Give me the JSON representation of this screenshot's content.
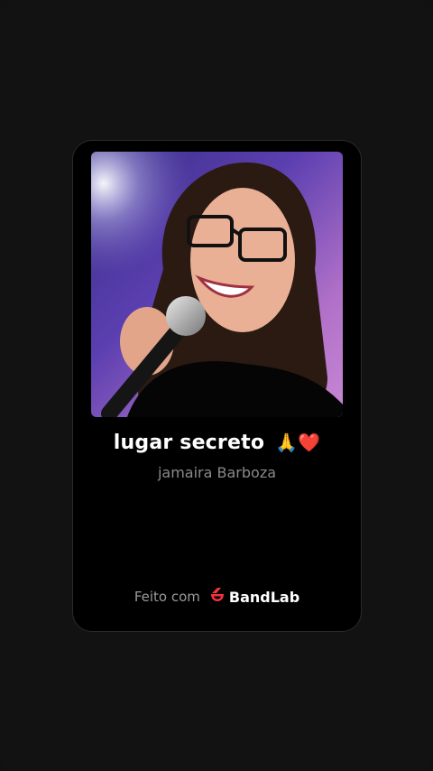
{
  "track": {
    "title": "lugar secreto",
    "title_emojis": "🙏❤️",
    "artist": "jamaira Barboza"
  },
  "footer": {
    "made_with": "Feito com",
    "brand": "BandLab",
    "brand_color": "#f5323c"
  },
  "colors": {
    "background": "#121212",
    "card": "#000000",
    "title": "#ffffff",
    "artist": "#8a8a8a"
  }
}
